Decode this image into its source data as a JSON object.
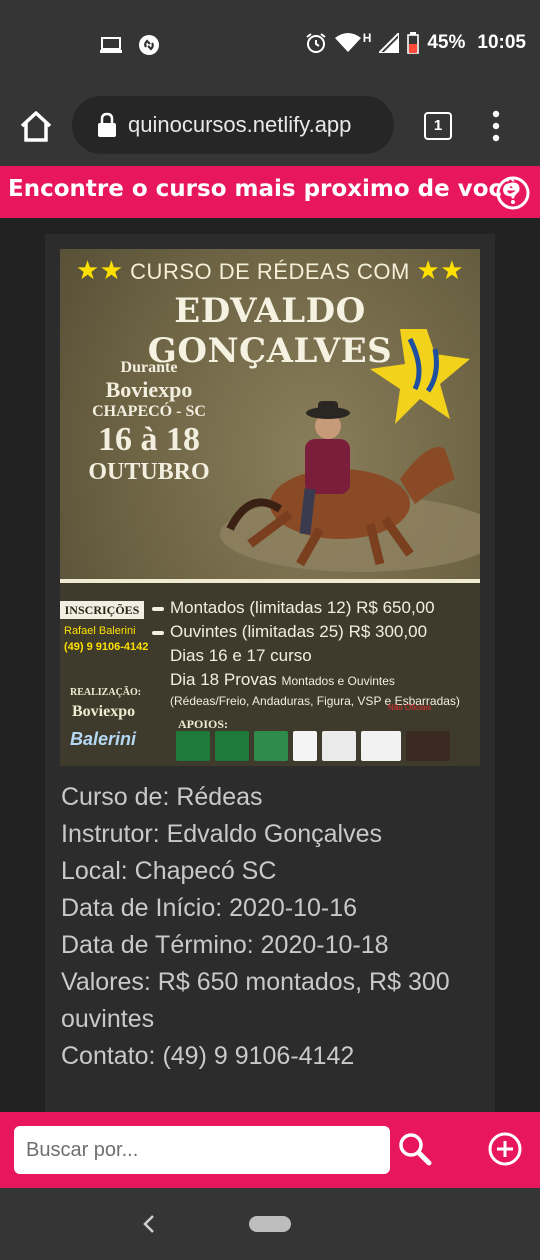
{
  "status_bar": {
    "battery": "45%",
    "time": "10:05",
    "network": "H"
  },
  "browser": {
    "url": "quinocursos.netlify.app",
    "tab_count": "1"
  },
  "header": {
    "title": "Encontre o curso mais proximo de você"
  },
  "poster": {
    "top_line": "CURSO  DE RÉDEAS COM",
    "name": "EDVALDO GONÇALVES",
    "durante": "Durante",
    "event": "Boviexpo",
    "city": "CHAPECÓ - SC",
    "dates": "16 à 18",
    "month": "OUTUBRO",
    "inscricoes_label": "INSCRIÇÕES",
    "contact_name": "Rafael  Balerini",
    "contact_phone": "(49) 9 9106-4142",
    "line_montados": "Montados (limitadas 12) R$ 650,00",
    "line_ouvintes": "Ouvintes (limitadas 25) R$ 300,00",
    "line_dias": "Dias 16 e 17 curso",
    "line_dia18": "Dia 18 Provas",
    "line_dia18_small": "Montados e Ouvintes",
    "line_provas": "(Rédeas/Freio, Andaduras, Figura, VSP e Esbarradas)",
    "nao_oficiais": "Não Oficiais",
    "realizacao_label": "REALIZAÇÃO:",
    "realizacao_value": "Boviexpo",
    "balerini_logo": "Balerini",
    "apoios_label": "APOIOS:"
  },
  "course": {
    "curso": "Curso de: Rédeas",
    "instrutor": "Instrutor: Edvaldo Gonçalves",
    "local": "Local: Chapecó SC",
    "inicio": "Data de Início: 2020-10-16",
    "termino": "Data de Término: 2020-10-18",
    "valores": "Valores: R$ 650 montados, R$ 300 ouvintes",
    "contato": "Contato: (49) 9 9106-4142"
  },
  "search": {
    "placeholder": "Buscar por..."
  },
  "colors": {
    "accent": "#e8175d",
    "background": "#222222",
    "card": "#2c2c2c",
    "bars": "#353535"
  }
}
